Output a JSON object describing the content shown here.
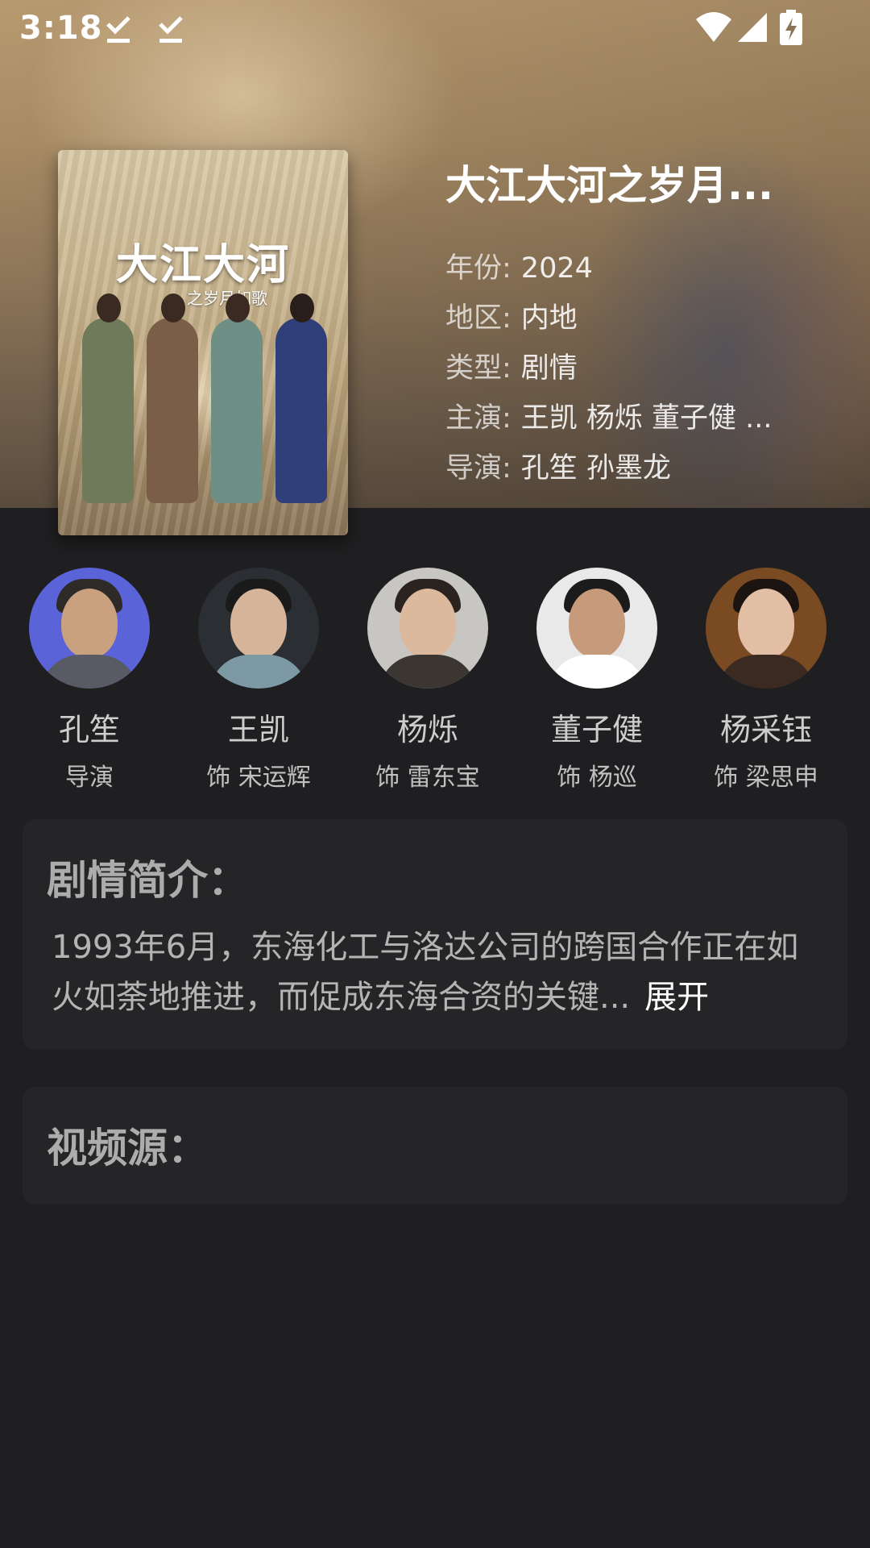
{
  "status_bar": {
    "time": "3:18",
    "icons": [
      "download-done-icon",
      "download-done-icon",
      "wifi-icon",
      "cell-signal-icon",
      "battery-charging-icon"
    ]
  },
  "movie": {
    "title": "大江大河之岁月...",
    "poster": {
      "title_art": "大江大河",
      "subtitle_art": "之岁月如歌"
    },
    "info": [
      {
        "label": "年份:",
        "value": "2024"
      },
      {
        "label": "地区:",
        "value": "内地"
      },
      {
        "label": "类型:",
        "value": "剧情"
      },
      {
        "label": "主演:",
        "value": "王凯 杨烁 董子健 ..."
      },
      {
        "label": "导演:",
        "value": "孔笙 孙墨龙"
      }
    ]
  },
  "cast": [
    {
      "name": "孔笙",
      "role": "导演"
    },
    {
      "name": "王凯",
      "role": "饰 宋运辉"
    },
    {
      "name": "杨烁",
      "role": "饰 雷东宝"
    },
    {
      "name": "董子健",
      "role": "饰 杨巡"
    },
    {
      "name": "杨采钰",
      "role": "饰 梁思申"
    }
  ],
  "synopsis": {
    "heading": "剧情简介：",
    "text": "1993年6月，东海化工与洛达公司的跨国合作正在如火如荼地推进，而促成东海合资的关键...",
    "expand_label": "展开"
  },
  "sources": {
    "heading": "视频源："
  },
  "colors": {
    "background": "#1f1f21",
    "card": "#252527",
    "text_primary": "#ffffff"
  }
}
